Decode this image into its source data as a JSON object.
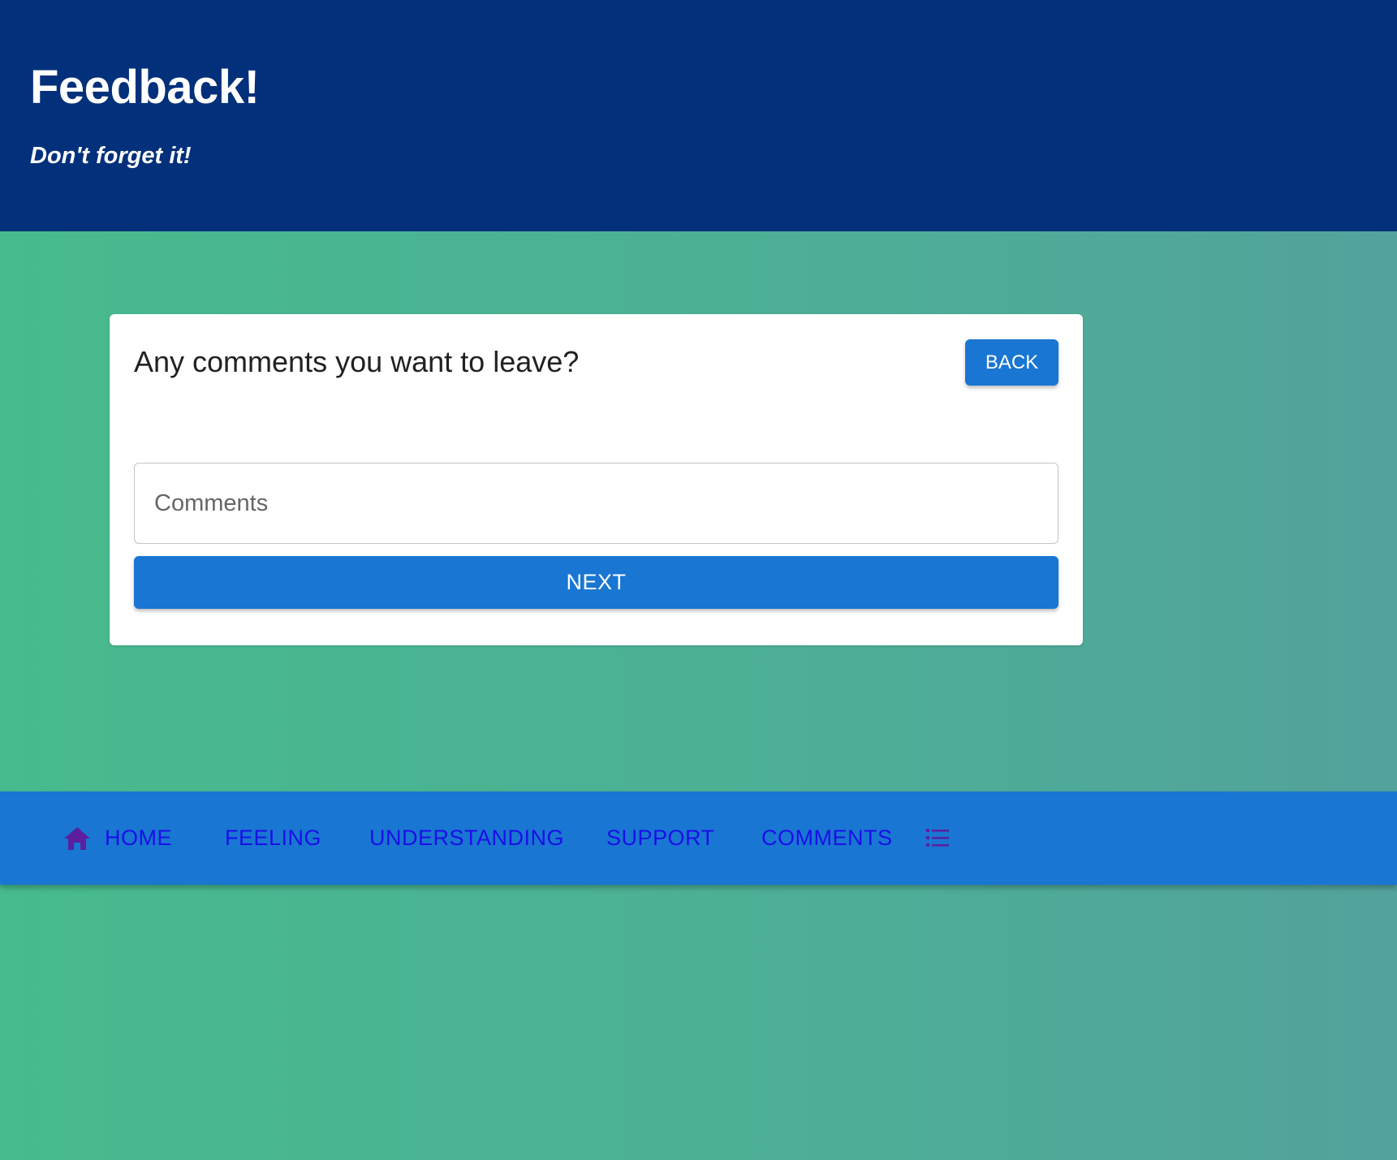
{
  "header": {
    "title": "Feedback!",
    "subtitle": "Don't forget it!"
  },
  "card": {
    "question": "Any comments you want to leave?",
    "back_label": "BACK",
    "comments_placeholder": "Comments",
    "comments_value": "",
    "next_label": "NEXT"
  },
  "nav": {
    "items": [
      {
        "label": "HOME",
        "icon": "home-icon"
      },
      {
        "label": "FEELING"
      },
      {
        "label": "UNDERSTANDING"
      },
      {
        "label": "SUPPORT"
      },
      {
        "label": "COMMENTS"
      }
    ],
    "list_icon": "list-icon"
  },
  "colors": {
    "header_bg": "#03307a",
    "accent": "#1976d2",
    "nav_text": "#1a0fe8",
    "nav_icon": "#5b1fa0",
    "background_gradient_start": "#47bb8d",
    "background_gradient_end": "#53a29c"
  }
}
